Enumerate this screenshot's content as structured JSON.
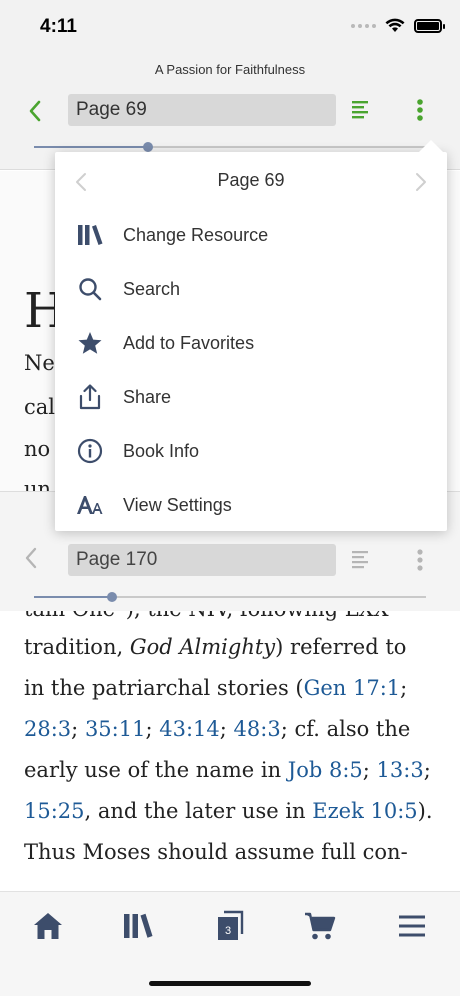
{
  "status_bar": {
    "time": "4:11"
  },
  "top_reader": {
    "book_title": "A Passion for Faithfulness",
    "page_field": "Page 69",
    "slider_fraction": 0.29,
    "accent_color": "#4aa42f"
  },
  "popup": {
    "page_label": "Page 69",
    "items": [
      {
        "label": "Change Resource",
        "icon": "library-icon"
      },
      {
        "label": "Search",
        "icon": "search-icon"
      },
      {
        "label": "Add to Favorites",
        "icon": "star-icon"
      },
      {
        "label": "Share",
        "icon": "share-icon"
      },
      {
        "label": "Book Info",
        "icon": "info-icon"
      },
      {
        "label": "View Settings",
        "icon": "text-size-icon"
      }
    ]
  },
  "pane1_fragments": {
    "big_letter": "H",
    "line1": "Ne",
    "line2": "cal",
    "line3": "no",
    "line4": "un"
  },
  "bottom_reader": {
    "page_field": "Page 170",
    "slider_fraction": 0.2
  },
  "reading": {
    "cut_line": "tain One”), the NIV, following LXX",
    "segments": {
      "l1a": "tradition, ",
      "l1b": "God Almighty",
      "l1c": ") referred to",
      "l2a": "in the patriarchal stories (",
      "l2link": "Gen 17:1",
      "l2b": ";",
      "l3link1": "28:3",
      "l3sep1": "; ",
      "l3link2": "35:11",
      "l3sep2": "; ",
      "l3link3": "43:14",
      "l3sep3": "; ",
      "l3link4": "48:3",
      "l3b": "; cf. also the",
      "l4a": "early use of the name in ",
      "l4link1": "Job 8:5",
      "l4sep": "; ",
      "l4link2": "13:3",
      "l4b": ";",
      "l5link1": "15:25",
      "l5a": ", and the later use in ",
      "l5link2": "Ezek 10:5",
      "l5b": ").",
      "l6": "Thus Moses should assume full con-"
    },
    "link_color": "#1e5a96"
  },
  "tab_bar": {
    "tabs": [
      "home-icon",
      "library-icon",
      "documents-icon",
      "cart-icon",
      "menu-icon"
    ],
    "documents_badge": "3",
    "icon_color": "#3d4d6b"
  }
}
